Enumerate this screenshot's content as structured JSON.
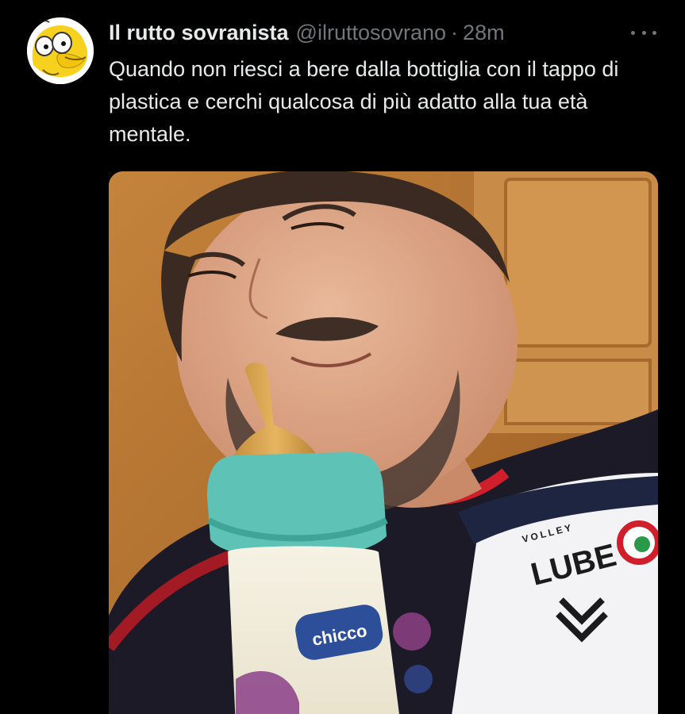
{
  "tweet": {
    "display_name": "Il rutto sovranista",
    "handle": "@ilruttosovrano",
    "separator": "·",
    "time": "28m",
    "text": "Quando non riesci a bere dalla bottiglia con il tappo di plastica e cerchi qualcosa di più adatto alla tua età mentale.",
    "avatar_icon": "cartoon-face-avatar",
    "more_icon": "more-options-icon"
  },
  "media": {
    "bottle_brand": "chicco",
    "shirt_small_text": "VOLLEY",
    "shirt_logo_text": "LUBE"
  }
}
